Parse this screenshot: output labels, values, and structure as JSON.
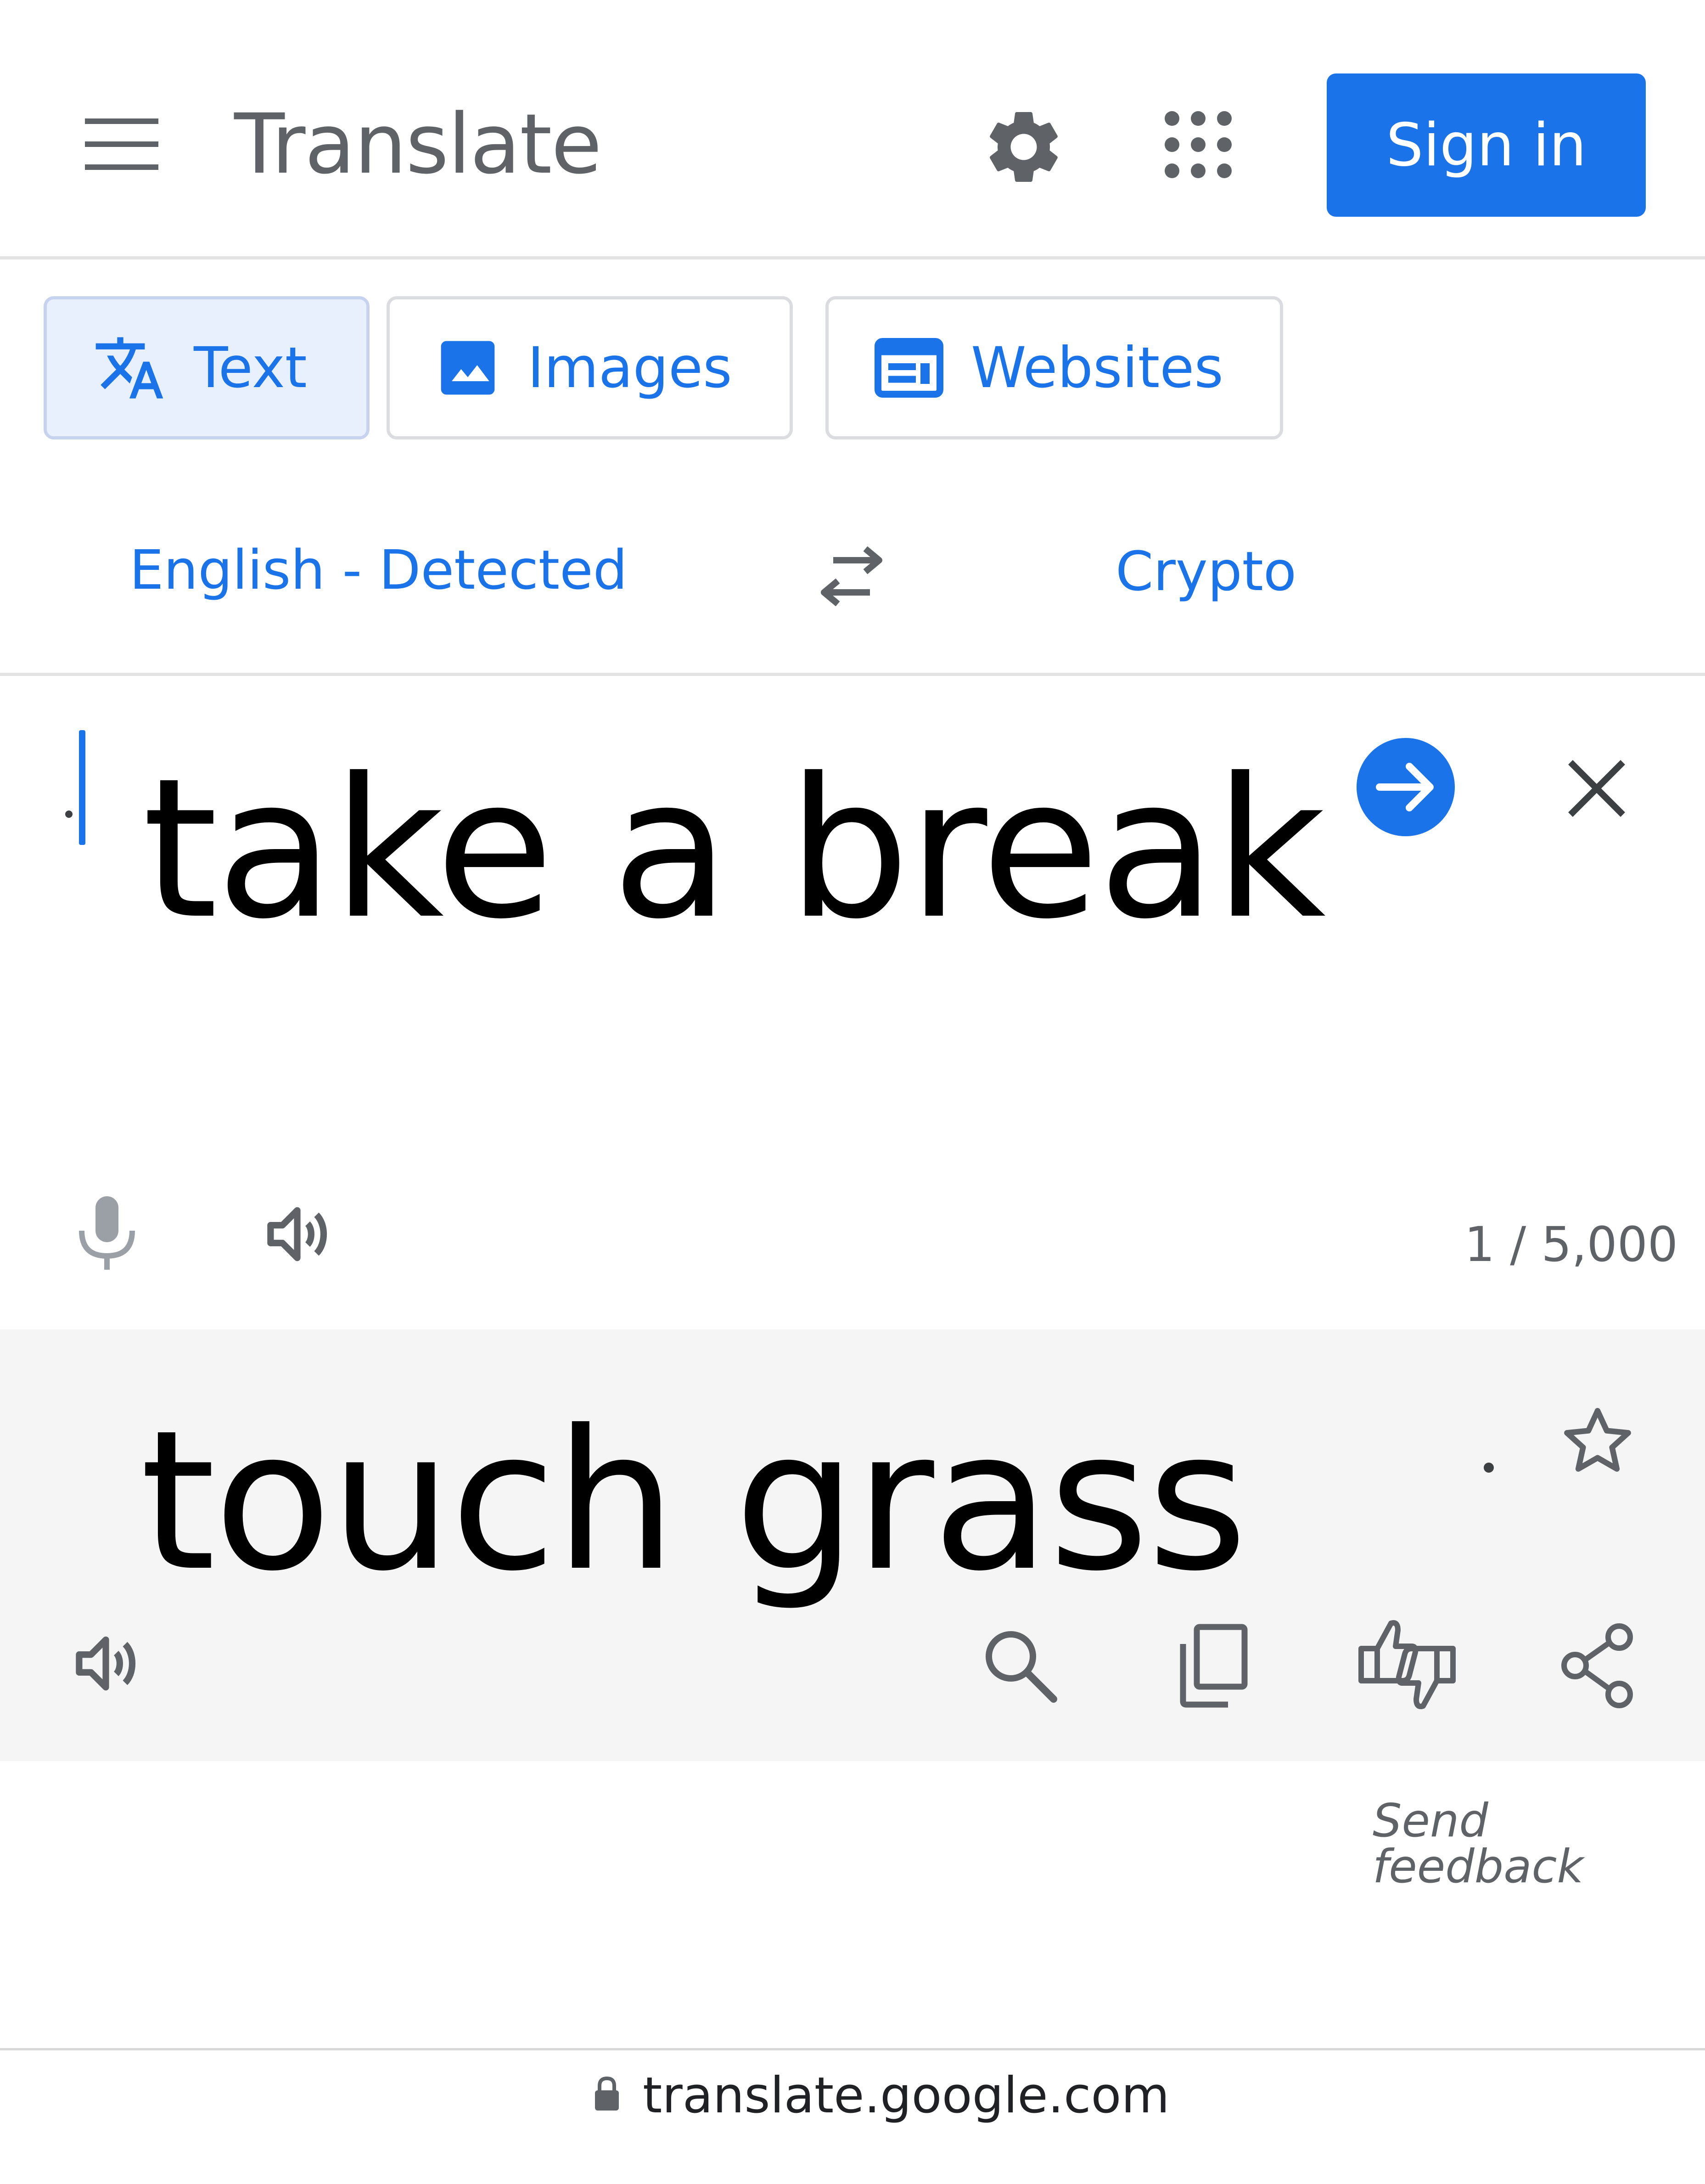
{
  "header": {
    "title": "Translate",
    "menu_icon": "hamburger-menu-icon",
    "settings_icon": "gear-icon",
    "apps_icon": "apps-grid-icon",
    "sign_in_label": "Sign in"
  },
  "mode_tabs": [
    {
      "label": "Text",
      "icon": "translate-icon",
      "active": true
    },
    {
      "label": "Images",
      "icon": "image-icon",
      "active": false
    },
    {
      "label": "Websites",
      "icon": "website-icon",
      "active": false
    }
  ],
  "languages": {
    "source": "English - Detected",
    "target": "Crypto",
    "swap_icon": "swap-icon"
  },
  "source": {
    "text": "take a break",
    "char_count": "1 / 5,000",
    "translate_icon": "arrow-right-circle-icon",
    "clear_icon": "close-icon",
    "mic_icon": "microphone-icon",
    "speaker_icon": "speaker-icon"
  },
  "result": {
    "text": "touch grass",
    "star_icon": "star-icon",
    "speaker_icon": "speaker-icon",
    "search_icon": "search-icon",
    "copy_icon": "copy-icon",
    "rate_icon": "thumbs-up-down-icon",
    "share_icon": "share-icon"
  },
  "feedback_label": "Send feedback",
  "url_bar": {
    "url": "translate.google.com",
    "lock_icon": "lock-icon"
  },
  "colors": {
    "accent": "#1a73e8",
    "icon_gray": "#5f6368",
    "result_bg": "#f5f5f5",
    "active_tab_bg": "#e8f0fe"
  }
}
